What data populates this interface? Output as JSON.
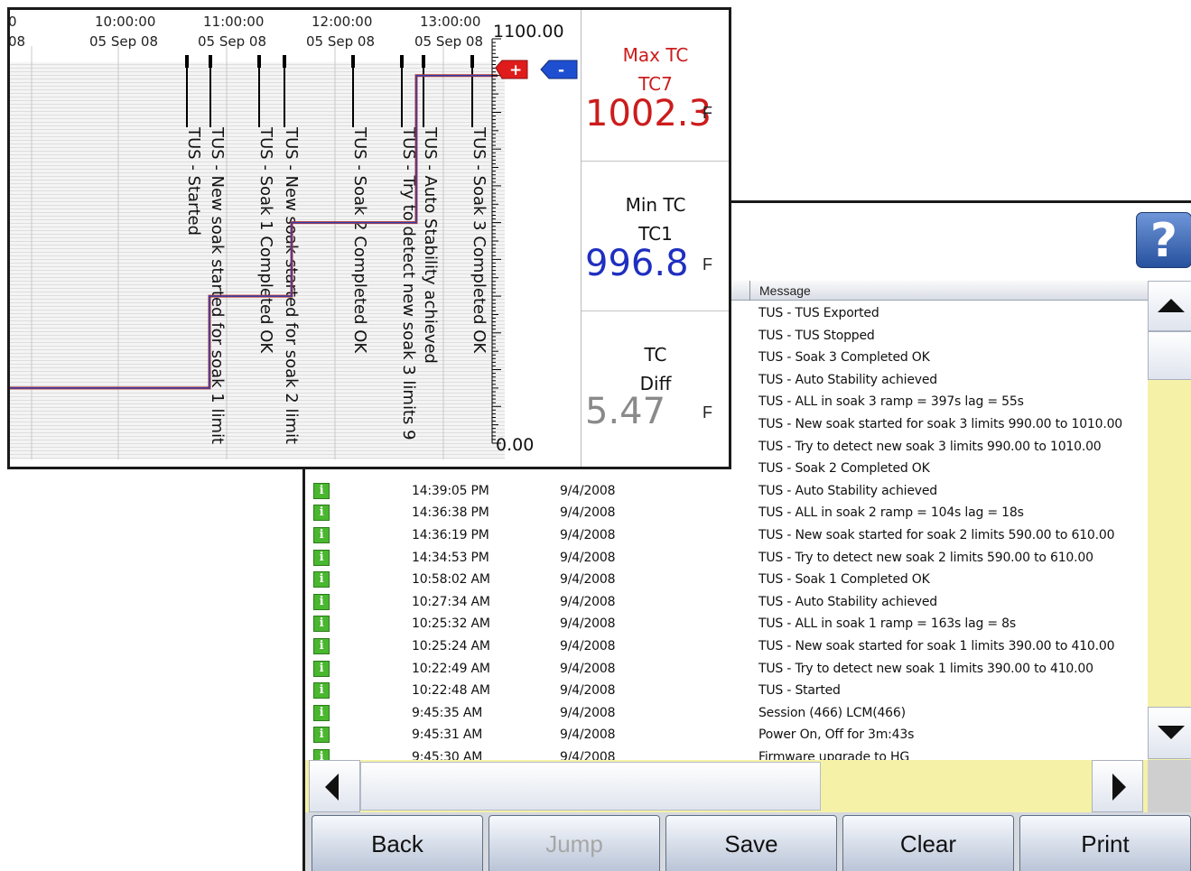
{
  "log": {
    "header_message": "Message",
    "help_label": "?",
    "rows_top": [
      {
        "msg": "TUS - TUS Exported"
      },
      {
        "msg": "TUS - TUS Stopped"
      },
      {
        "msg": "TUS - Soak 3 Completed OK"
      },
      {
        "msg": "TUS - Auto Stability achieved"
      },
      {
        "msg": "TUS - ALL in soak 3 ramp = 397s lag = 55s"
      },
      {
        "msg": "TUS - New soak started for soak 3 limits 990.00 to 1010.00"
      },
      {
        "msg": "TUS - Try to detect new soak 3 limits 990.00 to 1010.00"
      },
      {
        "msg": "TUS - Soak 2 Completed OK"
      }
    ],
    "rows": [
      {
        "icon": "i",
        "time": "14:39:05 PM",
        "date": "9/4/2008",
        "msg": "TUS - Auto Stability achieved"
      },
      {
        "icon": "i",
        "time": "14:36:38 PM",
        "date": "9/4/2008",
        "msg": "TUS - ALL in soak 2 ramp = 104s lag = 18s"
      },
      {
        "icon": "i",
        "time": "14:36:19 PM",
        "date": "9/4/2008",
        "msg": "TUS - New soak started for soak 2 limits 590.00 to 610.00"
      },
      {
        "icon": "i",
        "time": "14:34:53 PM",
        "date": "9/4/2008",
        "msg": "TUS - Try to detect new soak 2 limits 590.00 to 610.00"
      },
      {
        "icon": "i",
        "time": "10:58:02 AM",
        "date": "9/4/2008",
        "msg": "TUS - Soak 1 Completed OK"
      },
      {
        "icon": "i",
        "time": "10:27:34 AM",
        "date": "9/4/2008",
        "msg": "TUS - Auto Stability achieved"
      },
      {
        "icon": "i",
        "time": "10:25:32 AM",
        "date": "9/4/2008",
        "msg": "TUS - ALL in soak 1 ramp = 163s lag = 8s"
      },
      {
        "icon": "i",
        "time": "10:25:24 AM",
        "date": "9/4/2008",
        "msg": "TUS - New soak started for soak 1 limits 390.00 to 410.00"
      },
      {
        "icon": "i",
        "time": "10:22:49 AM",
        "date": "9/4/2008",
        "msg": "TUS - Try to detect new soak 1 limits 390.00 to 410.00"
      },
      {
        "icon": "i",
        "time": "10:22:48 AM",
        "date": "9/4/2008",
        "msg": "TUS - Started"
      },
      {
        "icon": "i",
        "time": "9:45:35 AM",
        "date": "9/4/2008",
        "msg": "Session (466) LCM(466)"
      },
      {
        "icon": "i",
        "time": "9:45:31 AM",
        "date": "9/4/2008",
        "msg": "Power On, Off for 3m:43s"
      },
      {
        "icon": "i",
        "time": "9:45:30 AM",
        "date": "9/4/2008",
        "msg": "Firmware upgrade to HG"
      }
    ]
  },
  "buttons": {
    "back": "Back",
    "jump": "Jump",
    "save": "Save",
    "clear": "Clear",
    "print": "Print"
  },
  "chart": {
    "time_labels": [
      {
        "time": "0",
        "date": "08"
      },
      {
        "time": "10:00:00",
        "date": "05 Sep 08"
      },
      {
        "time": "11:00:00",
        "date": "05 Sep 08"
      },
      {
        "time": "12:00:00",
        "date": "05 Sep 08"
      },
      {
        "time": "13:00:00",
        "date": "05 Sep 08"
      }
    ],
    "ymax_label": "1100.00",
    "ymin_label": "0.00",
    "plus_label": "+",
    "minus_label": "-",
    "events": [
      "TUS - Started",
      "TUS - New soak started for soak 1 limit",
      "TUS - Soak 1 Completed OK",
      "TUS - New soak started for soak 2 limit",
      "TUS - Soak 2 Completed OK",
      "TUS - Try to detect new soak 3 limits 9",
      "TUS - Auto Stability achieved",
      "TUS - Soak 3 Completed OK"
    ],
    "colors": {
      "trace_red": "#c0392b",
      "trace_blue": "#2f3fae",
      "plus": "#e01b1b",
      "minus": "#1f4fd1"
    }
  },
  "chart_data": {
    "type": "line",
    "ylim": [
      0,
      1100
    ],
    "series": [
      {
        "values": [
          150,
          150,
          150,
          400,
          400,
          600,
          600,
          1000,
          1000
        ]
      }
    ]
  },
  "side": {
    "max_title": "Max TC",
    "max_channel": "TC7",
    "max_value": "1002.3",
    "max_unit": "F",
    "min_title": "Min TC",
    "min_channel": "TC1",
    "min_value": "996.8",
    "min_unit": "F",
    "diff_title": "TC",
    "diff_sub": "Diff",
    "diff_value": "5.47",
    "diff_unit": "F",
    "colors": {
      "max": "#cc1c1c",
      "min": "#1f2fc0",
      "diff": "#8a8a8a"
    }
  }
}
